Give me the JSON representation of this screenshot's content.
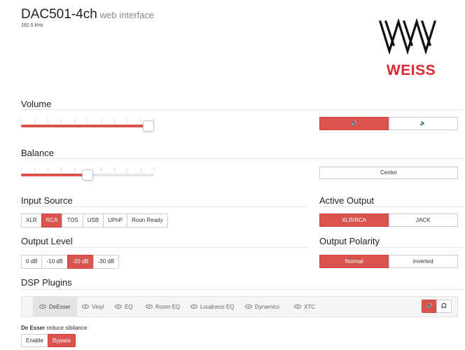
{
  "header": {
    "device": "DAC501-4ch",
    "subtitle": "web interface",
    "sample_rate": "192.0 kHz"
  },
  "logo": {
    "text": "WEISS",
    "color": "#d9262f"
  },
  "volume": {
    "heading": "Volume",
    "level": 0.96,
    "speaker_icon": "🔊",
    "mute_icon": "🔈"
  },
  "balance": {
    "heading": "Balance",
    "position": 0.5,
    "center_label": "Center"
  },
  "input_source": {
    "heading": "Input Source",
    "options": [
      "XLR",
      "RCA",
      "TOS",
      "USB",
      "UPnP",
      "Roon Ready"
    ],
    "selected": "RCA"
  },
  "active_output": {
    "heading": "Active Output",
    "options": [
      "XLR/RCA",
      "JACK"
    ],
    "selected": "XLR/RCA"
  },
  "output_level": {
    "heading": "Output Level",
    "options": [
      "0 dB",
      "-10 dB",
      "-20 dB",
      "-30 dB"
    ],
    "selected": "-20 dB"
  },
  "output_polarity": {
    "heading": "Output Polarity",
    "options": [
      "Normal",
      "Inverted"
    ],
    "selected": "Normal"
  },
  "dsp": {
    "heading": "DSP Plugins",
    "tabs": [
      "DeEsser",
      "Vinyl",
      "EQ",
      "Room EQ",
      "Loudness EQ",
      "Dynamics",
      "XTC"
    ],
    "active_tab": "DeEsser",
    "speaker_icon": "🔊",
    "headphone_icon": "🎧"
  },
  "plugin_detail": {
    "name": "De Esser",
    "description": "reduce sibilance",
    "buttons": [
      "Enable",
      "Bypass"
    ],
    "selected": "Bypass"
  },
  "colors": {
    "accent": "#d9534f",
    "brand": "#d9262f"
  }
}
